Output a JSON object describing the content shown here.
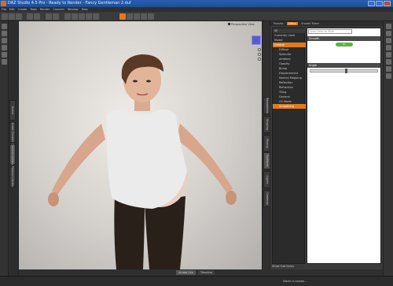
{
  "window": {
    "title": "DAZ Studio 4.5 Pro - Ready to Render - Fancy Gentleman 2.duf"
  },
  "menu": [
    "File",
    "Edit",
    "Create",
    "Tools",
    "Render",
    "Connect",
    "Window",
    "Help"
  ],
  "left_tabs": [
    "Scene",
    "Smart Content",
    "Content Library",
    "Product Library"
  ],
  "viewport": {
    "camera_label": "Perspective View"
  },
  "mid_tabs": [
    "Parameters",
    "Shaping",
    "Posing",
    "Surfaces",
    "Lights",
    "Cameras"
  ],
  "surfaces": {
    "tabs": [
      "Presets",
      "Editor",
      "Shader Mixer"
    ],
    "active_tab": "Editor",
    "tree": {
      "header_all": "All",
      "currently_used": "Currently Used",
      "model_label": "Model",
      "selected_group": "Default",
      "items": [
        "Diffuse",
        "Specular",
        "Ambient",
        "Opacity",
        "Bump",
        "Displacement",
        "Normal Mapping",
        "Reflection",
        "Refraction",
        "Tiling",
        "General",
        "UV Mode",
        "Smoothing"
      ]
    },
    "filter_placeholder": "Type Here to filter",
    "props": {
      "smooth_label": "Smooth",
      "smooth_value": "On",
      "angle_label": "Angle"
    },
    "show_sub_items": "Show Sub Items"
  },
  "bottom": {
    "tabs": [
      "Aniate Lite",
      "Timeline"
    ],
    "lesson": "Select a Lesson..."
  }
}
